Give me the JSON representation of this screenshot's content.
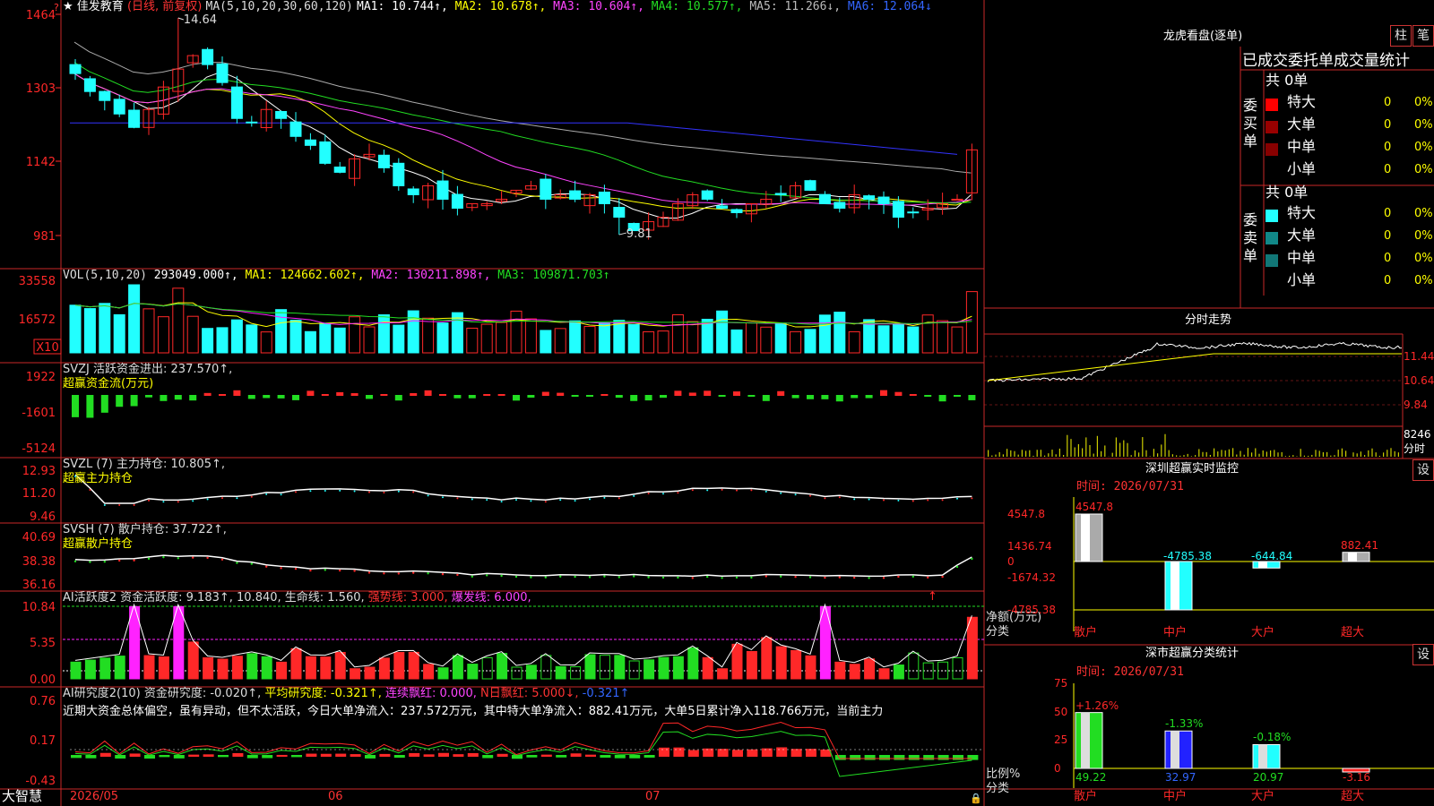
{
  "colors": {
    "up": "#ff2828",
    "down": "#22ffff",
    "flat": "#ffffff",
    "border": "#c82828",
    "ma1": "#ffffff",
    "ma2": "#ffff00",
    "ma3": "#ff44ff",
    "ma4": "#22dd22",
    "ma5": "#aaaaaa",
    "ma6": "#3333ff",
    "green": "#22dd22",
    "magenta": "#ff22ff",
    "yellow": "#ffff00"
  },
  "kline": {
    "title_star": "★",
    "stock_name": "佳发教育",
    "period": "(日线, 前复权)",
    "ma_label": "MA(5,10,20,30,60,120)",
    "ma_values": [
      {
        "label": "MA1: 10.744↑,",
        "color": "#ffffff"
      },
      {
        "label": "MA2: 10.678↑,",
        "color": "#ffff00"
      },
      {
        "label": "MA3: 10.604↑,",
        "color": "#ff44ff"
      },
      {
        "label": "MA4: 10.577↑,",
        "color": "#22dd22"
      },
      {
        "label": "MA5: 11.266↓,",
        "color": "#bbbbbb"
      },
      {
        "label": "MA6: 12.064↓",
        "color": "#3366ff"
      }
    ],
    "axis_ticks": [
      "1464",
      "1303",
      "1142",
      "981"
    ],
    "high_label": "14.64",
    "low_label": "9.81",
    "corner_mark": "?"
  },
  "vol": {
    "label": "VOL(5,10,20)",
    "value": "293049.000↑,",
    "ma1": "MA1: 124662.602↑,",
    "ma2": "MA2: 130211.898↑,",
    "ma3": "MA3: 109871.703↑",
    "axis_ticks": [
      "33558",
      "16572"
    ],
    "unit": "X10"
  },
  "svzj": {
    "label": "SVZJ  活跃资金进出: 237.570↑,",
    "sublabel": "超赢资金流(万元)",
    "axis_ticks": [
      "1922",
      "-1601",
      "-5124"
    ]
  },
  "svzl": {
    "label": "SVZL (7) 主力持仓: 10.805↑,",
    "sublabel": "超赢主力持仓",
    "axis_ticks": [
      "12.93",
      "11.20",
      "9.46"
    ]
  },
  "svsh": {
    "label": "SVSH (7) 散户持仓: 37.722↑,",
    "sublabel": "超赢散户持仓",
    "axis_ticks": [
      "40.69",
      "38.38",
      "36.16"
    ]
  },
  "ai1": {
    "label": "AI活跃度2 资金活跃度: 9.183↑, 10.840, 生命线: 1.560,",
    "strong": "强势线: 3.000,",
    "burst": "爆发线: 6.000,",
    "axis_ticks": [
      "10.84",
      "5.35",
      "0.00"
    ]
  },
  "ai2": {
    "label": "AI研究度2(10) 资金研究度: -0.020↑,",
    "avg": "平均研究度: -0.321↑,",
    "cont": "连续飘红: 0.000,",
    "nday": "N日飘红: 5.000↓,",
    "extra": "-0.321↑",
    "commentary": "近期大资金总体偏空，虽有异动，但不太活跃，今日大单净流入：237.572万元，其中特大单净流入：882.41万元，大单5日累计净入118.766万元，当前主力",
    "axis_ticks": [
      "0.76",
      "0.17",
      "-0.43"
    ]
  },
  "bottom": {
    "brand": "大智慧",
    "dates": [
      "2026/05",
      "06",
      "07"
    ]
  },
  "lhb": {
    "title": "龙虎看盘(逐单)",
    "btn1": "柱",
    "btn2": "笔",
    "header": "已成交委托单成交量统计",
    "buy_side": "委买单",
    "sell_side": "委卖单",
    "buy_total": "共 0单",
    "sell_total": "共 0单",
    "buy_rows": [
      {
        "name": "特大",
        "v": "0",
        "p": "0%",
        "color": "#ff0000"
      },
      {
        "name": "大单",
        "v": "0",
        "p": "0%",
        "color": "#990000"
      },
      {
        "name": "中单",
        "v": "0",
        "p": "0%",
        "color": "#880000"
      },
      {
        "name": "小单",
        "v": "0",
        "p": "0%",
        "color": ""
      }
    ],
    "sell_rows": [
      {
        "name": "特大",
        "v": "0",
        "p": "0%",
        "color": "#22ffff"
      },
      {
        "name": "大单",
        "v": "0",
        "p": "0%",
        "color": "#118888"
      },
      {
        "name": "中单",
        "v": "0",
        "p": "0%",
        "color": "#117777"
      },
      {
        "name": "小单",
        "v": "0",
        "p": "0%",
        "color": ""
      }
    ]
  },
  "fenshi": {
    "title": "分时走势",
    "axis": [
      "11.44",
      "10.64",
      "9.84"
    ],
    "vol_label": "8246",
    "vol_unit": "分时"
  },
  "monitor": {
    "title": "深圳超赢实时监控",
    "btn": "设",
    "time": "时间: 2026/07/31",
    "yaxis": [
      "4547.8",
      "1436.74",
      "0",
      "-1674.32",
      "-4785.38"
    ],
    "ylabel": "净额(万元)",
    "xlabel": "分类",
    "bars": [
      {
        "cat": "散户",
        "value": 4547.8,
        "label": "4547.8"
      },
      {
        "cat": "中户",
        "value": -4785.38,
        "label": "-4785.38"
      },
      {
        "cat": "大户",
        "value": -644.84,
        "label": "-644.84"
      },
      {
        "cat": "超大",
        "value": 882.41,
        "label": "882.41"
      }
    ]
  },
  "classify": {
    "title": "深市超赢分类统计",
    "btn": "设",
    "time": "时间: 2026/07/31",
    "yaxis": [
      "75",
      "50",
      "25",
      "0"
    ],
    "ylabel": "比例%",
    "xlabel": "分类",
    "bars": [
      {
        "cat": "散户",
        "value": 49.22,
        "delta": "+1.26%",
        "label": "49.22"
      },
      {
        "cat": "中户",
        "value": 32.97,
        "delta": "-1.33%",
        "label": "32.97"
      },
      {
        "cat": "大户",
        "value": 20.97,
        "delta": "-0.18%",
        "label": "20.97"
      },
      {
        "cat": "超大",
        "value": -3.16,
        "delta": "",
        "label": "-3.16"
      }
    ]
  }
}
